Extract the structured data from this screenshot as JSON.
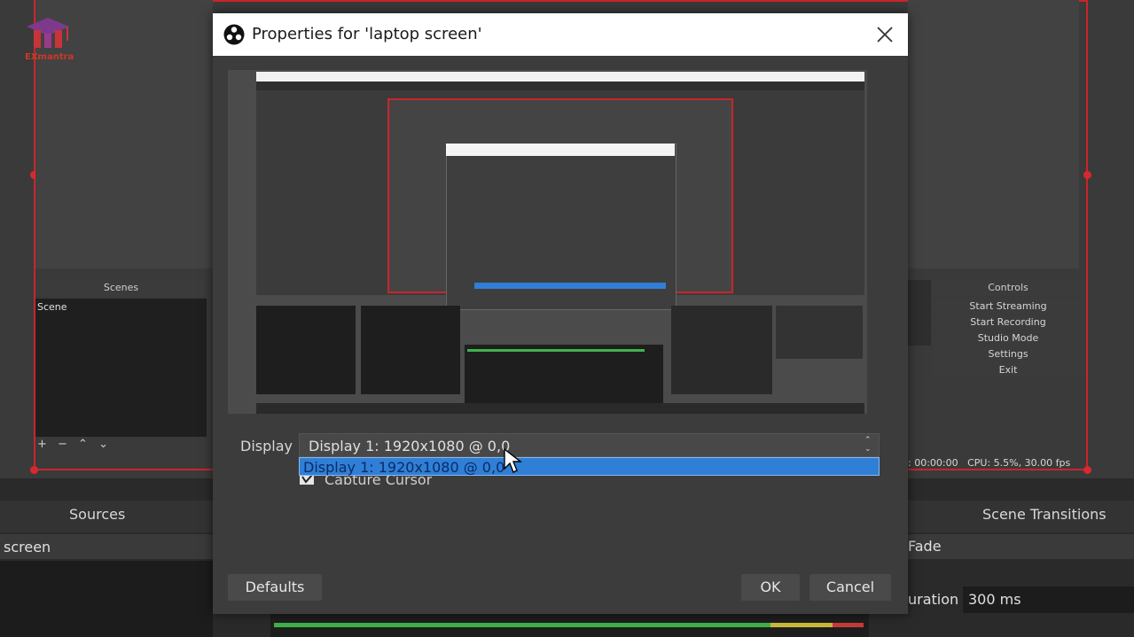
{
  "background": {
    "logo_text": "EXmantra",
    "scenes_header": "Scenes",
    "scene_item": "Scene",
    "controls_header": "Controls",
    "controls": [
      "Start Streaming",
      "Start Recording",
      "Studio Mode",
      "Settings",
      "Exit"
    ],
    "status_text": ": 00:00:00   CPU: 5.5%, 30.00 fps",
    "sources_title": "Sources",
    "source_item": "screen",
    "scene_transitions_title": "Scene Transitions",
    "transition_value": "Fade",
    "duration_label": "uration",
    "duration_value": "300 ms"
  },
  "dialog": {
    "title": "Properties for 'laptop screen'",
    "display_label": "Display",
    "display_value": "Display 1: 1920x1080 @ 0,0",
    "dropdown_option": "Display 1: 1920x1080 @ 0,0",
    "capture_cursor_label": "Capture Cursor",
    "defaults_label": "Defaults",
    "ok_label": "OK",
    "cancel_label": "Cancel"
  },
  "colors": {
    "accent_red": "#c9252b",
    "selection_blue": "#2f7fd6"
  }
}
